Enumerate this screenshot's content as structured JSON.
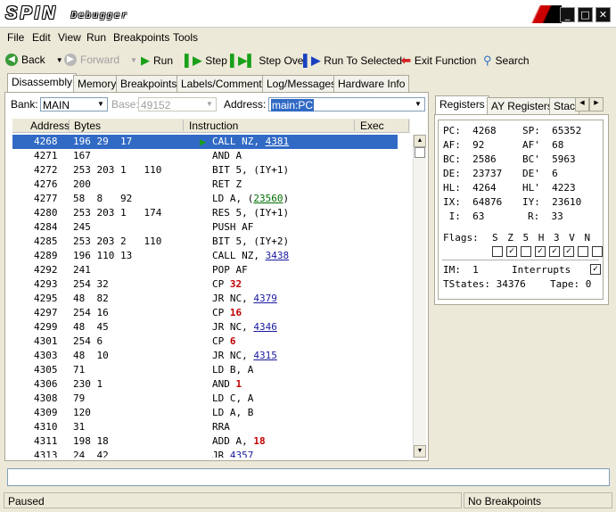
{
  "window": {
    "logo": "SPIN",
    "subtitle": "Debugger"
  },
  "menu": [
    "File",
    "Edit",
    "View",
    "Run",
    "Breakpoints",
    "Tools"
  ],
  "toolbar": {
    "back": "Back",
    "forward": "Forward",
    "run": "Run",
    "step": "Step",
    "step_over": "Step Over",
    "run_to_selected": "Run To Selected",
    "exit_function": "Exit Function",
    "search": "Search"
  },
  "tabs": [
    "Disassembly",
    "Memory",
    "Breakpoints",
    "Labels/Comments",
    "Log/Messages",
    "Hardware Info"
  ],
  "bank": {
    "label": "Bank:",
    "value": "MAIN",
    "base_label": "Base:",
    "base_value": "49152",
    "address_label": "Address:",
    "address_value": "main:PC"
  },
  "columns": [
    "Address",
    "Bytes",
    "Instruction",
    "Exec"
  ],
  "rows": [
    {
      "addr": "4268",
      "bytes": "196 29  17",
      "ins": "CALL NZ, ",
      "arg": "4381",
      "kind": "link",
      "selected": true
    },
    {
      "addr": "4271",
      "bytes": "167",
      "ins": "AND A",
      "arg": "",
      "kind": ""
    },
    {
      "addr": "4272",
      "bytes": "253 203 1   110",
      "ins": "BIT 5, (IY+1)",
      "arg": "",
      "kind": ""
    },
    {
      "addr": "4276",
      "bytes": "200",
      "ins": "RET Z",
      "arg": "",
      "kind": ""
    },
    {
      "addr": "4277",
      "bytes": "58  8   92",
      "ins": "LD A, (",
      "arg": "23560",
      "kind": "green",
      "tail": ")"
    },
    {
      "addr": "4280",
      "bytes": "253 203 1   174",
      "ins": "RES 5, (IY+1)",
      "arg": "",
      "kind": ""
    },
    {
      "addr": "4284",
      "bytes": "245",
      "ins": "PUSH AF",
      "arg": "",
      "kind": ""
    },
    {
      "addr": "4285",
      "bytes": "253 203 2   110",
      "ins": "BIT 5, (IY+2)",
      "arg": "",
      "kind": ""
    },
    {
      "addr": "4289",
      "bytes": "196 110 13",
      "ins": "CALL NZ, ",
      "arg": "3438",
      "kind": "link"
    },
    {
      "addr": "4292",
      "bytes": "241",
      "ins": "POP AF",
      "arg": "",
      "kind": ""
    },
    {
      "addr": "4293",
      "bytes": "254 32",
      "ins": "CP ",
      "arg": "32",
      "kind": "red"
    },
    {
      "addr": "4295",
      "bytes": "48  82",
      "ins": "JR NC, ",
      "arg": "4379",
      "kind": "link"
    },
    {
      "addr": "4297",
      "bytes": "254 16",
      "ins": "CP ",
      "arg": "16",
      "kind": "red"
    },
    {
      "addr": "4299",
      "bytes": "48  45",
      "ins": "JR NC, ",
      "arg": "4346",
      "kind": "link"
    },
    {
      "addr": "4301",
      "bytes": "254 6",
      "ins": "CP ",
      "arg": "6",
      "kind": "red"
    },
    {
      "addr": "4303",
      "bytes": "48  10",
      "ins": "JR NC, ",
      "arg": "4315",
      "kind": "link"
    },
    {
      "addr": "4305",
      "bytes": "71",
      "ins": "LD B, A",
      "arg": "",
      "kind": ""
    },
    {
      "addr": "4306",
      "bytes": "230 1",
      "ins": "AND ",
      "arg": "1",
      "kind": "red"
    },
    {
      "addr": "4308",
      "bytes": "79",
      "ins": "LD C, A",
      "arg": "",
      "kind": ""
    },
    {
      "addr": "4309",
      "bytes": "120",
      "ins": "LD A, B",
      "arg": "",
      "kind": ""
    },
    {
      "addr": "4310",
      "bytes": "31",
      "ins": "RRA",
      "arg": "",
      "kind": ""
    },
    {
      "addr": "4311",
      "bytes": "198 18",
      "ins": "ADD A, ",
      "arg": "18",
      "kind": "red"
    },
    {
      "addr": "4313",
      "bytes": "24  42",
      "ins": "JR ",
      "arg": "4357",
      "kind": "link"
    }
  ],
  "right_tabs": [
    "Registers",
    "AY Registers",
    "Stac"
  ],
  "registers": {
    "pc": "PC:  4268",
    "sp": "SP:  65352",
    "af": "AF:  92",
    "af2": "AF'  68",
    "bc": "BC:  2586",
    "bc2": "BC'  5963",
    "de": "DE:  23737",
    "de2": "DE'  6",
    "hl": "HL:  4264",
    "hl2": "HL'  4223",
    "ix": "IX:  64876",
    "iy": "IY:  23610",
    "i": " I:  63",
    "r": "R:  33",
    "flags_label": "Flags:",
    "flag_names": "S Z 5 H 3 V N",
    "flags": [
      false,
      true,
      false,
      true,
      true,
      true,
      false,
      false
    ],
    "im": "IM:  1",
    "interrupts": "Interrupts",
    "interrupts_on": true,
    "tstates": "TStates: 34376",
    "tape": "Tape: 0"
  },
  "status": {
    "left": "Paused",
    "right": "No Breakpoints"
  },
  "colors": {
    "selection": "#316ac5",
    "link": "#1a1aa0",
    "green_link": "#007000",
    "literal": "#c00000"
  }
}
